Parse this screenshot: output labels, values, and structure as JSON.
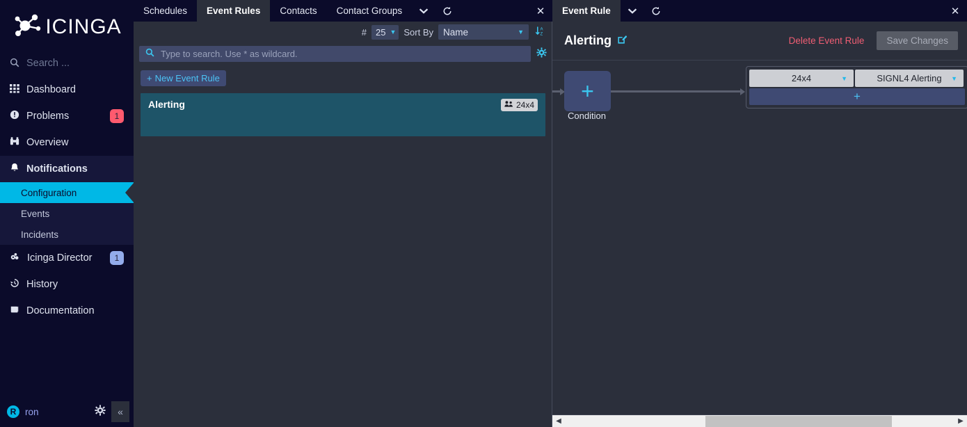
{
  "sidebar": {
    "logo_text": "ICINGA",
    "logo_icon": "icinga-molecule-logo",
    "search_placeholder": "Search ...",
    "items": [
      {
        "label": "Dashboard",
        "icon": "grid-icon",
        "badge": null
      },
      {
        "label": "Problems",
        "icon": "exclamation-circle-icon",
        "badge": "1"
      },
      {
        "label": "Overview",
        "icon": "binoculars-icon",
        "badge": null
      },
      {
        "label": "Notifications",
        "icon": "bell-icon",
        "badge": null
      }
    ],
    "sub_items": [
      {
        "label": "Configuration",
        "selected": true
      },
      {
        "label": "Events",
        "selected": false
      },
      {
        "label": "Incidents",
        "selected": false
      }
    ],
    "items_after": [
      {
        "label": "Icinga Director",
        "icon": "director-icon",
        "badge": "1"
      },
      {
        "label": "History",
        "icon": "history-icon",
        "badge": null
      },
      {
        "label": "Documentation",
        "icon": "book-icon",
        "badge": null
      }
    ],
    "user": {
      "initial": "R",
      "name": "ron"
    },
    "gear_icon": "gear-icon",
    "collapse_icon": "double-chevron-left-icon"
  },
  "center": {
    "tabs": [
      {
        "label": "Schedules",
        "active": false
      },
      {
        "label": "Event Rules",
        "active": true
      },
      {
        "label": "Contacts",
        "active": false
      },
      {
        "label": "Contact Groups",
        "active": false
      }
    ],
    "tab_dropdown_icon": "chevron-down-icon",
    "tab_refresh_icon": "refresh-icon",
    "tab_close_icon": "close-icon",
    "controls": {
      "hash_label": "#",
      "page_size": "25",
      "sort_by_label": "Sort By",
      "sort_field": "Name",
      "sort_direction_icon": "sort-descending-icon"
    },
    "search": {
      "placeholder": "Type to search. Use * as wildcard.",
      "value": "",
      "icon": "search-icon",
      "settings_icon": "gear-icon"
    },
    "new_rule_button": "New Event Rule",
    "rules": [
      {
        "name": "Alerting",
        "badge": "24x4",
        "badge_icon": "users-icon",
        "selected": true
      }
    ]
  },
  "right": {
    "tab_label": "Event Rule",
    "tab_dropdown_icon": "chevron-down-icon",
    "tab_refresh_icon": "refresh-icon",
    "tab_close_icon": "close-icon",
    "title": "Alerting",
    "edit_icon": "pencil-edit-icon",
    "delete_link": "Delete Event Rule",
    "save_button": "Save Changes",
    "flow": {
      "condition_node": {
        "label": "Condition",
        "plus_icon": "plus-icon"
      },
      "escalation": {
        "recipient": "24x4",
        "channel": "SIGNL4 Alerting",
        "add_icon": "plus-icon",
        "dropdown_icon": "caret-down-icon"
      }
    }
  },
  "scrollbar": {
    "left_arrow_icon": "triangle-left-icon",
    "right_arrow_icon": "triangle-right-icon"
  },
  "colors": {
    "accent_cyan": "#00b8e6",
    "sidebar_bg": "#0b0b2a",
    "content_bg": "#2b2f3b",
    "selected_row": "#1e5468",
    "danger": "#ef5e73",
    "badge_red": "#ff5a6e",
    "badge_blue": "#93aceb"
  }
}
